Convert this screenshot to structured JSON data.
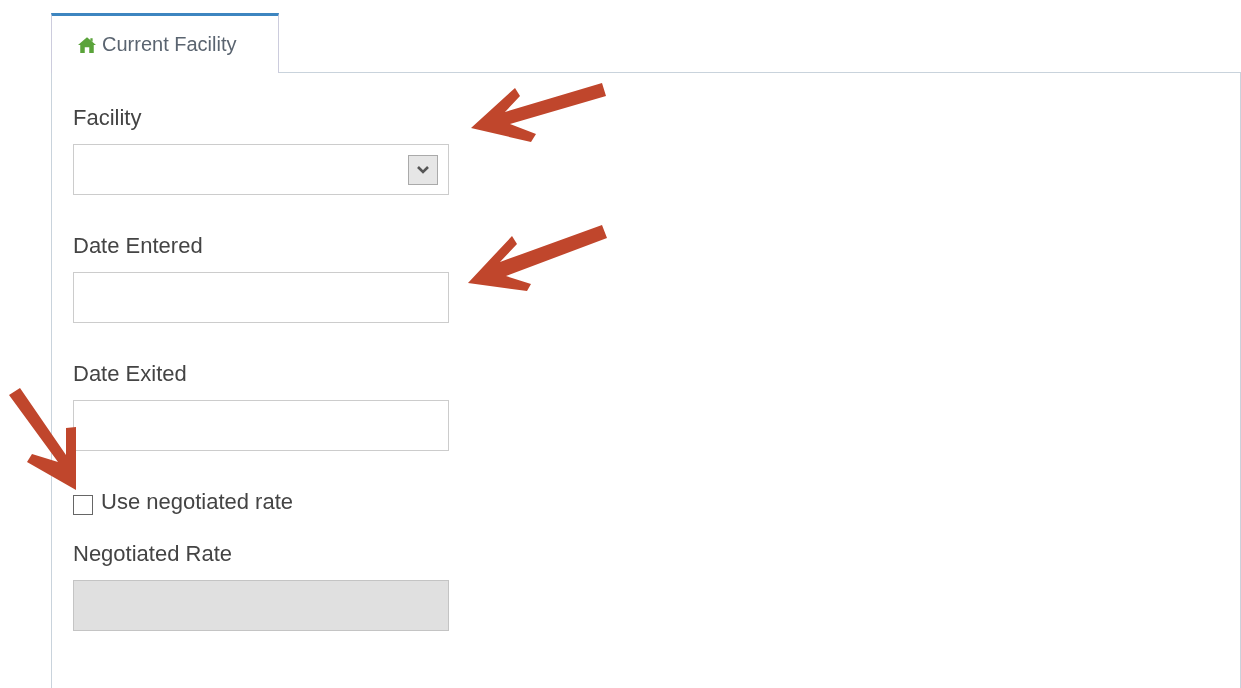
{
  "tab": {
    "label": "Current Facility",
    "selected": true
  },
  "fields": [
    {
      "kind": "select",
      "label": "Facility",
      "disabled": false
    },
    {
      "kind": "text",
      "label": "Date Entered",
      "disabled": false
    },
    {
      "kind": "text",
      "label": "Date Exited",
      "disabled": false
    },
    {
      "kind": "checkbox",
      "label": "Use negotiated rate",
      "checked": false
    },
    {
      "kind": "text",
      "label": "Negotiated Rate",
      "disabled": true
    }
  ]
}
